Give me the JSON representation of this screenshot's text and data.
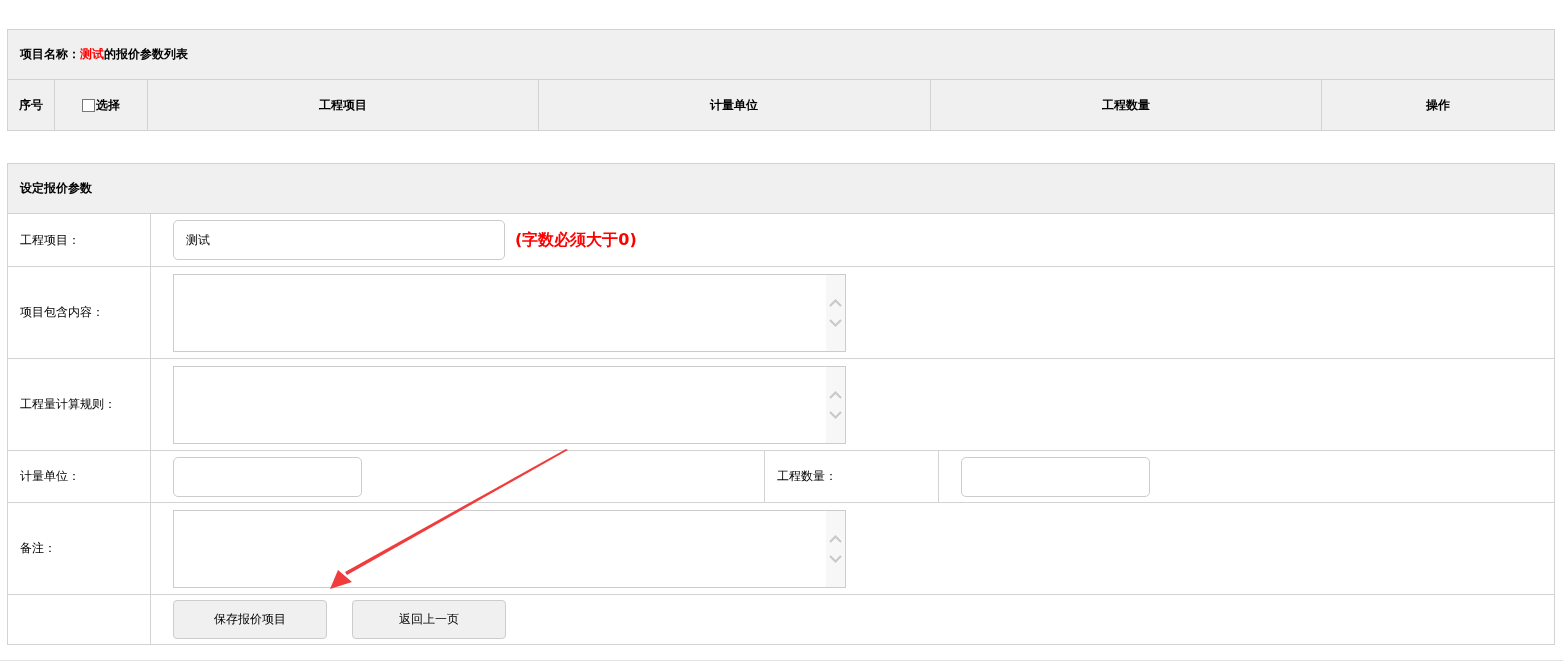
{
  "list_panel": {
    "title_prefix": "项目名称：",
    "project_name": "测试",
    "title_suffix": "的报价参数列表",
    "select_all": {
      "checked": false
    },
    "columns": [
      {
        "kind": "plain",
        "label": "序号"
      },
      {
        "kind": "select",
        "label": "选择"
      },
      {
        "kind": "plain",
        "label": "工程项目"
      },
      {
        "kind": "plain",
        "label": "计量单位"
      },
      {
        "kind": "plain",
        "label": "工程数量"
      },
      {
        "kind": "plain",
        "label": "操作"
      }
    ]
  },
  "form_panel": {
    "title": "设定报价参数",
    "fields": [
      {
        "kind": "input",
        "label": "工程项目：",
        "value": "测试",
        "hint": "(字数必须大于0)"
      },
      {
        "kind": "textarea",
        "label": "项目包含内容："
      },
      {
        "kind": "textarea",
        "label": "工程量计算规则："
      },
      {
        "kind": "pair",
        "label": "计量单位：",
        "second_label": "工程数量："
      },
      {
        "kind": "textarea",
        "label": "备注："
      }
    ],
    "buttons": [
      "保存报价项目",
      "返回上一页"
    ]
  }
}
